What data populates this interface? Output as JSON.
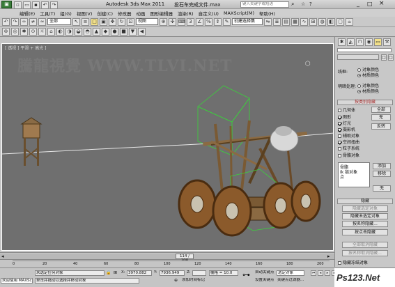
{
  "app": {
    "title": "Autodesk 3ds Max  2011",
    "file": "投石车完成文件.max",
    "search_placeholder": "键入关键字或短语",
    "window_controls": [
      "_",
      "□",
      "×"
    ]
  },
  "menu": [
    "编辑(E)",
    "工具(T)",
    "组(G)",
    "视图(V)",
    "创建(C)",
    "修改器",
    "动画",
    "图形编辑器",
    "渲染(R)",
    "自定义(U)",
    "MAXScript(M)",
    "帮助(H)"
  ],
  "toolbar": {
    "selection_filter": "全部",
    "ref_coord": "视图",
    "named_selection": "创建选择集"
  },
  "viewport": {
    "label": "[ 透视 ] 平滑 + 高光 ]",
    "watermark": "騰龍視覺 WWW.TLVI.NET"
  },
  "command_panel": {
    "top_buttons": [
      "□",
      "□"
    ],
    "display_color": {
      "wireframe_label": "线框:",
      "shaded_label": "明暗处理:",
      "options": [
        "对象颜色",
        "材质颜色"
      ],
      "wire_selected": 1,
      "shaded_selected": 1
    },
    "hide_by_category": {
      "title": "按类别隐藏",
      "items": [
        {
          "label": "几何体",
          "checked": false
        },
        {
          "label": "图形",
          "checked": true
        },
        {
          "label": "灯光",
          "checked": true
        },
        {
          "label": "摄影机",
          "checked": true
        },
        {
          "label": "辅助对象",
          "checked": false
        },
        {
          "label": "空间扭曲",
          "checked": true
        },
        {
          "label": "粒子系统",
          "checked": false
        },
        {
          "label": "骨骼对象",
          "checked": false
        }
      ],
      "buttons": [
        "全部",
        "无",
        "反转"
      ]
    },
    "list": {
      "items": [
        "骨骼",
        "Ik 链对象",
        "点"
      ],
      "buttons": [
        "添加",
        "移除",
        "无"
      ]
    },
    "hide": {
      "title": "隐藏",
      "buttons": [
        "隐藏选定对象",
        "隐藏未选定对象",
        "按名称隐藏...",
        "按点击隐藏"
      ],
      "disabled_buttons": [
        "全部取消隐藏",
        "按名称取消隐藏...",
        "隐藏冻结对象"
      ]
    },
    "checkbox_label": "隐藏冻结对象"
  },
  "timeline": {
    "slider": "114 / 200",
    "ticks": [
      "0",
      "20",
      "40",
      "60",
      "80",
      "100",
      "120",
      "140",
      "160",
      "180",
      "200"
    ]
  },
  "status": {
    "selection": "未选定任何对象",
    "prompt": "单击并拖动以选择并移动对象",
    "listener": "欢迎使用 MAXSc",
    "x_label": "X:",
    "x": "3970.882",
    "y_label": "Y:",
    "y": "7936.949",
    "z_label": "Z:",
    "grid": "栅格 = 10.0",
    "add_time_tag": "添加时间标记",
    "auto_key": "自动关键点",
    "set_key": "设置关键点",
    "selected_object": "选定对象",
    "key_filters": "关键点过滤器..."
  },
  "brand": "Ps123.Net"
}
